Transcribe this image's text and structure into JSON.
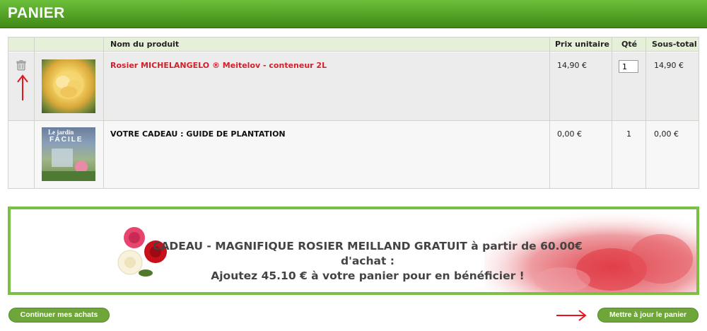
{
  "page": {
    "title": "PANIER"
  },
  "cart": {
    "headers": {
      "product": "Nom du produit",
      "unit_price": "Prix unitaire",
      "qty": "Qté",
      "subtotal": "Sous-total"
    },
    "items": [
      {
        "name": "Rosier MICHELANGELO ® Meitelov - conteneur 2L",
        "unit_price": "14,90 €",
        "qty": "1",
        "subtotal": "14,90 €"
      },
      {
        "name": "VOTRE CADEAU : GUIDE DE PLANTATION",
        "unit_price": "0,00 €",
        "qty": "1",
        "subtotal": "0,00 €",
        "thumb_text_1": "Le jardin",
        "thumb_text_2": "FACILE"
      }
    ]
  },
  "promo": {
    "line1": "CADEAU - MAGNIFIQUE ROSIER MEILLAND GRATUIT à partir de 60.00€ d'achat :",
    "line2": "Ajoutez 45.10 € à votre panier pour en bénéficier !"
  },
  "buttons": {
    "continue": "Continuer mes achats",
    "update": "Mettre à jour le panier"
  },
  "colors": {
    "brand_green": "#4f9a22",
    "link_red": "#d3202a",
    "annotation_red": "#e8141c"
  }
}
